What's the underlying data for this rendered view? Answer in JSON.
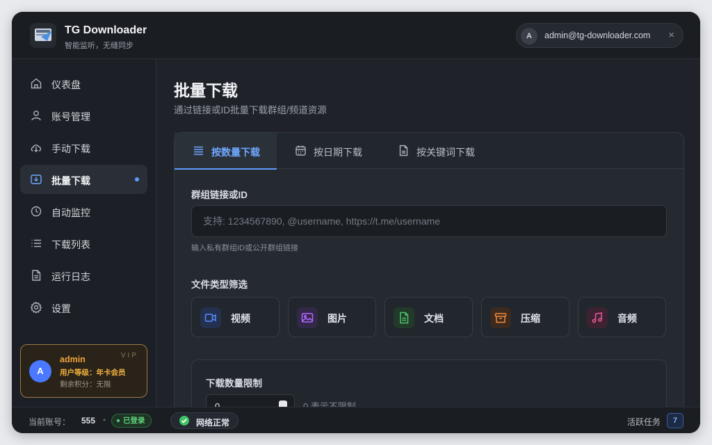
{
  "app": {
    "title": "TG Downloader",
    "subtitle": "智能监听，无缝同步"
  },
  "user": {
    "avatar_letter": "A",
    "email": "admin@tg-downloader.com",
    "close": "×"
  },
  "sidebar": {
    "items": [
      {
        "label": "仪表盘",
        "icon": "home-icon"
      },
      {
        "label": "账号管理",
        "icon": "user-icon"
      },
      {
        "label": "手动下载",
        "icon": "cloud-download-icon"
      },
      {
        "label": "批量下载",
        "icon": "batch-download-icon",
        "active": true
      },
      {
        "label": "自动监控",
        "icon": "clock-icon"
      },
      {
        "label": "下载列表",
        "icon": "list-icon"
      },
      {
        "label": "运行日志",
        "icon": "document-icon"
      },
      {
        "label": "设置",
        "icon": "gear-icon"
      }
    ],
    "vip": {
      "avatar_letter": "A",
      "name": "admin",
      "badge": "VIP",
      "level": "用户等级：年卡会员",
      "points": "剩余积分：无限"
    }
  },
  "main": {
    "title": "批量下载",
    "subtitle": "通过链接或ID批量下载群组/频道资源",
    "tabs": [
      {
        "label": "按数量下载",
        "icon": "list-lines-icon",
        "active": true
      },
      {
        "label": "按日期下载",
        "icon": "calendar-icon"
      },
      {
        "label": "按关键词下载",
        "icon": "file-icon"
      }
    ],
    "group_field": {
      "label": "群组链接或ID",
      "placeholder": "支持: 1234567890, @username, https://t.me/username",
      "value": "",
      "hint": "输入私有群组ID或公开群组链接"
    },
    "file_types": {
      "label": "文件类型筛选",
      "items": [
        {
          "label": "视频",
          "icon": "video-icon",
          "color": "#5b8cff",
          "bg": "#233050"
        },
        {
          "label": "图片",
          "icon": "image-icon",
          "color": "#b469ff",
          "bg": "#332848"
        },
        {
          "label": "文档",
          "icon": "document-icon",
          "color": "#4fc46a",
          "bg": "#213a2a"
        },
        {
          "label": "压缩",
          "icon": "archive-icon",
          "color": "#f28a3b",
          "bg": "#3d2a1e"
        },
        {
          "label": "音频",
          "icon": "music-icon",
          "color": "#ec5b9a",
          "bg": "#3d2232"
        }
      ]
    },
    "limit": {
      "label": "下载数量限制",
      "value": "0",
      "note": "0 表示不限制"
    }
  },
  "footer": {
    "account_label": "当前账号：",
    "account_value": "555",
    "separator": "•",
    "logged_in": "已登录",
    "network": "网络正常",
    "active_tasks_label": "活跃任务",
    "active_tasks_count": "7"
  }
}
